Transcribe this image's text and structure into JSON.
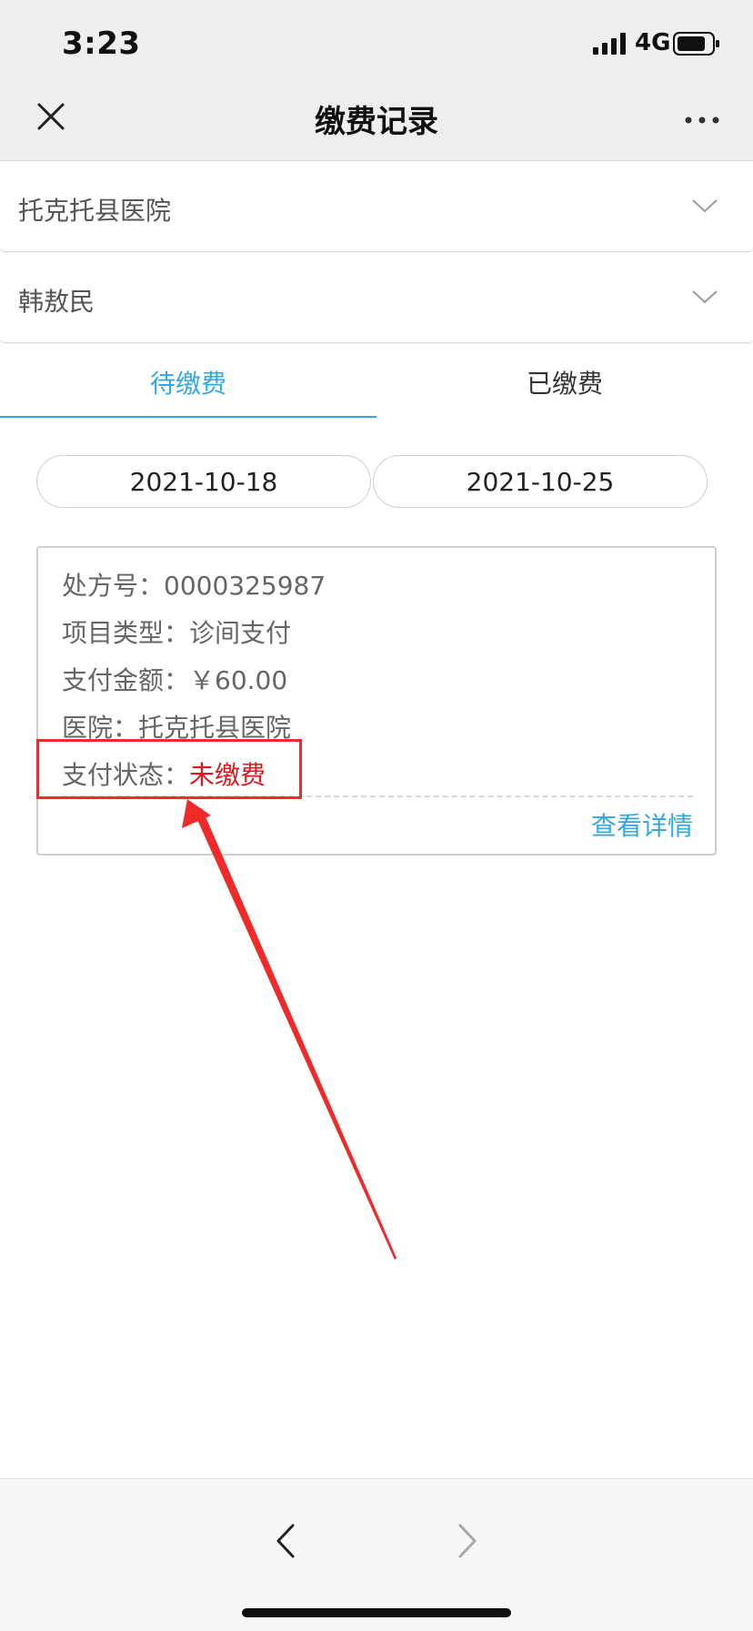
{
  "status_bar": {
    "time": "3:23",
    "network": "4G"
  },
  "nav": {
    "title": "缴费记录",
    "close_icon": "close-icon",
    "more_icon": "more-icon"
  },
  "filters": {
    "hospital": "托克托县医院",
    "patient": "韩敖民"
  },
  "tabs": [
    {
      "label": "待缴费",
      "active": true
    },
    {
      "label": "已缴费",
      "active": false
    }
  ],
  "date_range": {
    "start": "2021-10-18",
    "end": "2021-10-25"
  },
  "record": {
    "rx_label": "处方号：",
    "rx_value": "0000325987",
    "type_label": "项目类型：",
    "type_value": "诊间支付",
    "amount_label": "支付金额：",
    "amount_value": "￥60.00",
    "hospital_label": "医院：",
    "hospital_value": "托克托县医院",
    "status_label": "支付状态：",
    "status_value": "未缴费",
    "detail_link": "查看详情"
  },
  "colors": {
    "accent": "#2fa8e6",
    "status_unpaid": "#e0161e",
    "annotation": "#ee2a2a"
  }
}
